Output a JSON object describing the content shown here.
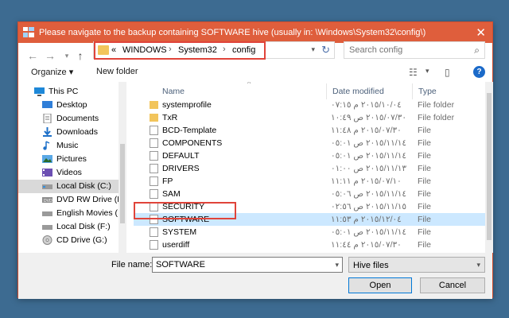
{
  "window": {
    "title": "Please navigate to the backup containing SOFTWARE hive (usually in: \\Windows\\System32\\config\\)",
    "close_glyph": "✕"
  },
  "address_bar": {
    "overflow": "«",
    "segments": [
      "WINDOWS",
      "System32",
      "config"
    ],
    "separator": "›"
  },
  "search": {
    "placeholder": "Search config"
  },
  "toolbar": {
    "organize_label": "Organize ▾",
    "new_folder_label": "New folder",
    "help_glyph": "?"
  },
  "nav_pane": {
    "items": [
      {
        "label": "This PC",
        "icon": "pc-icon"
      },
      {
        "label": "Desktop",
        "icon": "desktop-icon"
      },
      {
        "label": "Documents",
        "icon": "documents-icon"
      },
      {
        "label": "Downloads",
        "icon": "downloads-icon"
      },
      {
        "label": "Music",
        "icon": "music-icon"
      },
      {
        "label": "Pictures",
        "icon": "pictures-icon"
      },
      {
        "label": "Videos",
        "icon": "videos-icon"
      },
      {
        "label": "Local Disk (C:)",
        "icon": "drive-icon",
        "selected": true
      },
      {
        "label": "DVD RW Drive (D",
        "icon": "dvd-icon"
      },
      {
        "label": "English Movies (",
        "icon": "drive-icon"
      },
      {
        "label": "Local Disk (F:)",
        "icon": "drive-icon"
      },
      {
        "label": "CD Drive (G:)",
        "icon": "cd-icon"
      }
    ]
  },
  "file_list": {
    "columns": {
      "name": "Name",
      "date": "Date modified",
      "type": "Type"
    },
    "rows": [
      {
        "name": "systemprofile",
        "date": "٢٠١٥/١٠/٠٤ م ٠٧:١٥",
        "type": "File folder",
        "kind": "folder"
      },
      {
        "name": "TxR",
        "date": "٢٠١٥/٠٧/٣٠ ص ١٠:٤٩",
        "type": "File folder",
        "kind": "folder"
      },
      {
        "name": "BCD-Template",
        "date": "٢٠١٥/٠٧/٣٠ م ١١:٤٨",
        "type": "File",
        "kind": "file"
      },
      {
        "name": "COMPONENTS",
        "date": "٢٠١٥/١١/١٤ ص ٠٥:٠١",
        "type": "File",
        "kind": "file"
      },
      {
        "name": "DEFAULT",
        "date": "٢٠١٥/١١/١٤ ص ٠٥:٠١",
        "type": "File",
        "kind": "file"
      },
      {
        "name": "DRIVERS",
        "date": "٢٠١٥/١١/١٣ ص ٠١:٠٠",
        "type": "File",
        "kind": "file"
      },
      {
        "name": "FP",
        "date": "٢٠١٥/٠٧/١٠ م ١١:١١",
        "type": "File",
        "kind": "file"
      },
      {
        "name": "SAM",
        "date": "٢٠١٥/١١/١٤ ص ٠٥:٠٦",
        "type": "File",
        "kind": "file"
      },
      {
        "name": "SECURITY",
        "date": "٢٠١٥/١١/١٥ ص ٠٢:٥٦",
        "type": "File",
        "kind": "file"
      },
      {
        "name": "SOFTWARE",
        "date": "٢٠١٥/١٢/٠٤ م ١١:٥٣",
        "type": "File",
        "kind": "file",
        "selected": true
      },
      {
        "name": "SYSTEM",
        "date": "٢٠١٥/١١/١٤ ص ٠٥:٠١",
        "type": "File",
        "kind": "file"
      },
      {
        "name": "userdiff",
        "date": "٢٠١٥/٠٧/٣٠ م ١١:٤٤",
        "type": "File",
        "kind": "file"
      }
    ]
  },
  "footer": {
    "file_name_label": "File name:",
    "file_name_value": "SOFTWARE",
    "filter_value": "Hive files",
    "open_label": "Open",
    "cancel_label": "Cancel"
  },
  "colors": {
    "titlebar": "#df5e3c",
    "highlight_box": "#e0443a",
    "selected_row": "#cce8ff",
    "folder": "#f2c55c",
    "desktop_background": "#3d6b91"
  }
}
